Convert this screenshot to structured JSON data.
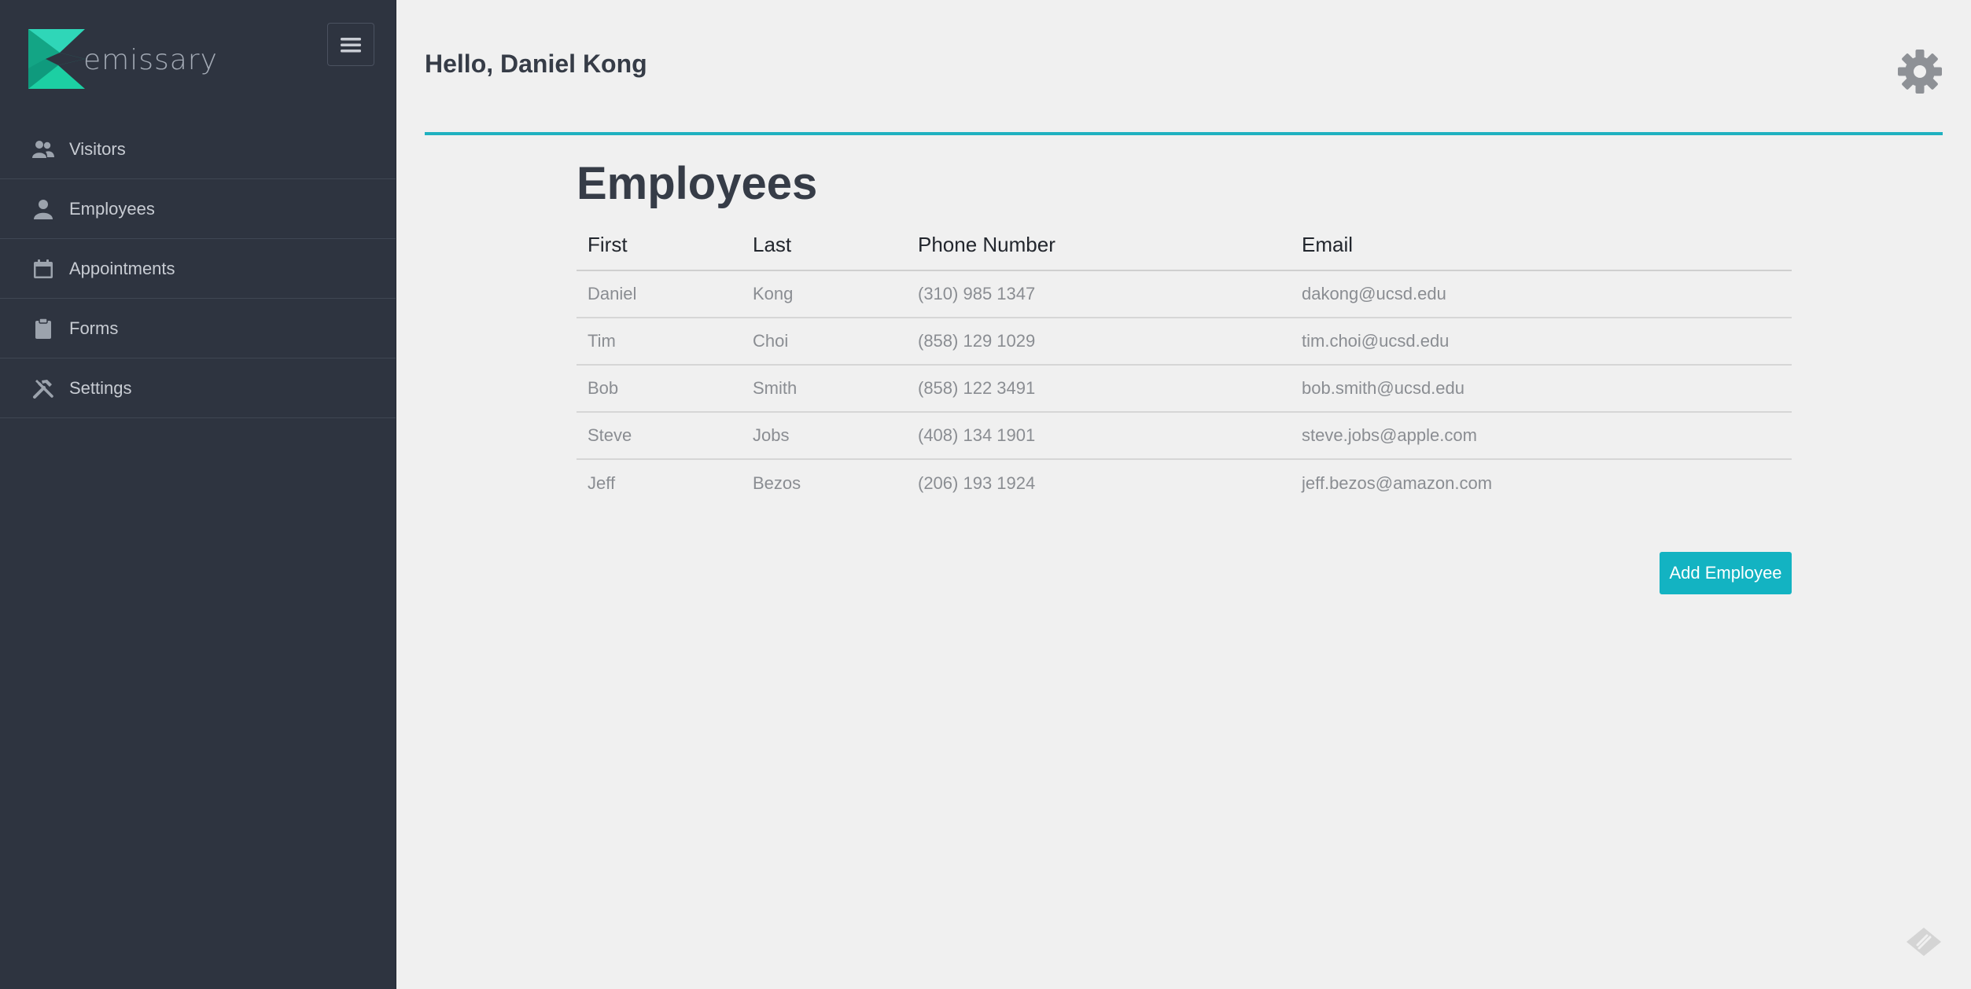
{
  "brand": {
    "name": "emissary",
    "colors": {
      "accent": "#13b3c2",
      "sidebar_bg": "#2e3440",
      "logo_teal": "#1ec9a4"
    }
  },
  "sidebar": {
    "toggle_icon": "hamburger-menu-icon",
    "items": [
      {
        "label": "Visitors",
        "icon": "visitors-icon"
      },
      {
        "label": "Employees",
        "icon": "employee-icon"
      },
      {
        "label": "Appointments",
        "icon": "calendar-icon"
      },
      {
        "label": "Forms",
        "icon": "clipboard-icon"
      },
      {
        "label": "Settings",
        "icon": "tools-icon"
      }
    ]
  },
  "header": {
    "greeting": "Hello, Daniel Kong",
    "settings_icon": "gear-icon"
  },
  "main": {
    "title": "Employees",
    "table": {
      "columns": [
        "First",
        "Last",
        "Phone Number",
        "Email"
      ],
      "rows": [
        [
          "Daniel",
          "Kong",
          "(310) 985 1347",
          "dakong@ucsd.edu"
        ],
        [
          "Tim",
          "Choi",
          "(858) 129 1029",
          "tim.choi@ucsd.edu"
        ],
        [
          "Bob",
          "Smith",
          "(858) 122 3491",
          "bob.smith@ucsd.edu"
        ],
        [
          "Steve",
          "Jobs",
          "(408) 134 1901",
          "steve.jobs@apple.com"
        ],
        [
          "Jeff",
          "Bezos",
          "(206) 193 1924",
          "jeff.bezos@amazon.com"
        ]
      ]
    },
    "add_button_label": "Add Employee"
  },
  "footer": {
    "feedback_icon": "feedback-icon"
  }
}
